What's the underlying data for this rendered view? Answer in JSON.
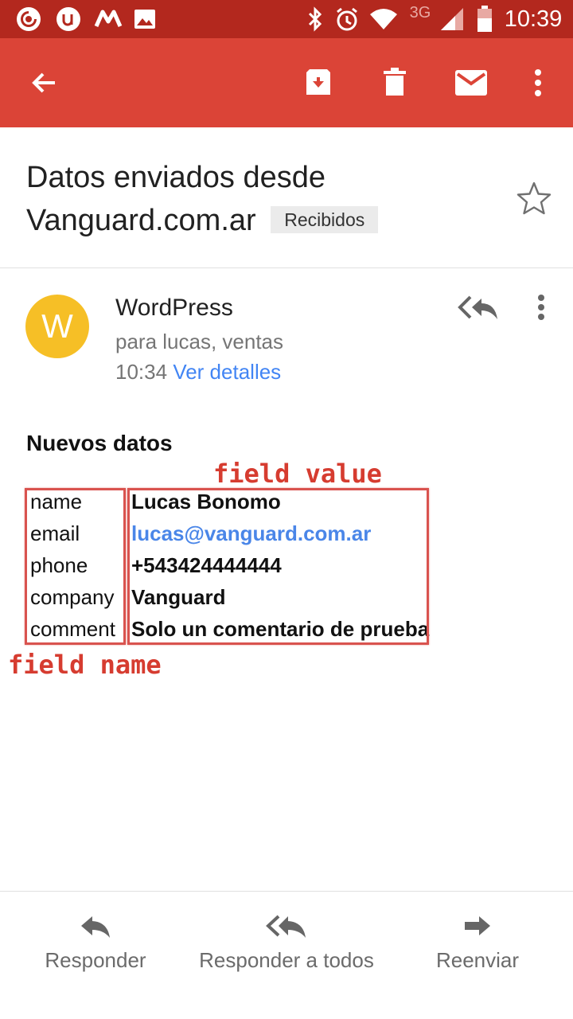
{
  "status_bar": {
    "time": "10:39",
    "network": "3G",
    "icons": [
      "pocket-casts-icon",
      "app-u-icon",
      "app-m-icon",
      "gallery-icon",
      "bluetooth-icon",
      "alarm-icon",
      "wifi-icon",
      "signal-icon",
      "battery-icon"
    ]
  },
  "app_bar": {
    "icons": [
      "back-arrow-icon",
      "archive-icon",
      "trash-icon",
      "mark-unread-icon",
      "more-vert-icon"
    ]
  },
  "email": {
    "subject": "Datos enviados desde Vanguard.com.ar",
    "label": "Recibidos",
    "sender": "WordPress",
    "avatar_letter": "W",
    "recipients": "para lucas, ventas",
    "time": "10:34",
    "details_link": "Ver detalles",
    "avatar_color": "#f6bf26"
  },
  "body": {
    "title": "Nuevos datos",
    "fields": [
      {
        "name": "name",
        "value": "Lucas Bonomo"
      },
      {
        "name": "email",
        "value": "lucas@vanguard.com.ar"
      },
      {
        "name": "phone",
        "value": "+543424444444"
      },
      {
        "name": "company",
        "value": "Vanguard"
      },
      {
        "name": "comment",
        "value": "Solo un comentario de prueba"
      }
    ]
  },
  "annotations": {
    "field_value": "field value",
    "field_name": "field name",
    "color": "#d63c30"
  },
  "bottom_actions": {
    "reply": "Responder",
    "reply_all": "Responder a todos",
    "forward": "Reenviar"
  },
  "colors": {
    "status_bar": "#b3281e",
    "app_bar": "#db4437",
    "link": "#4285f4"
  }
}
